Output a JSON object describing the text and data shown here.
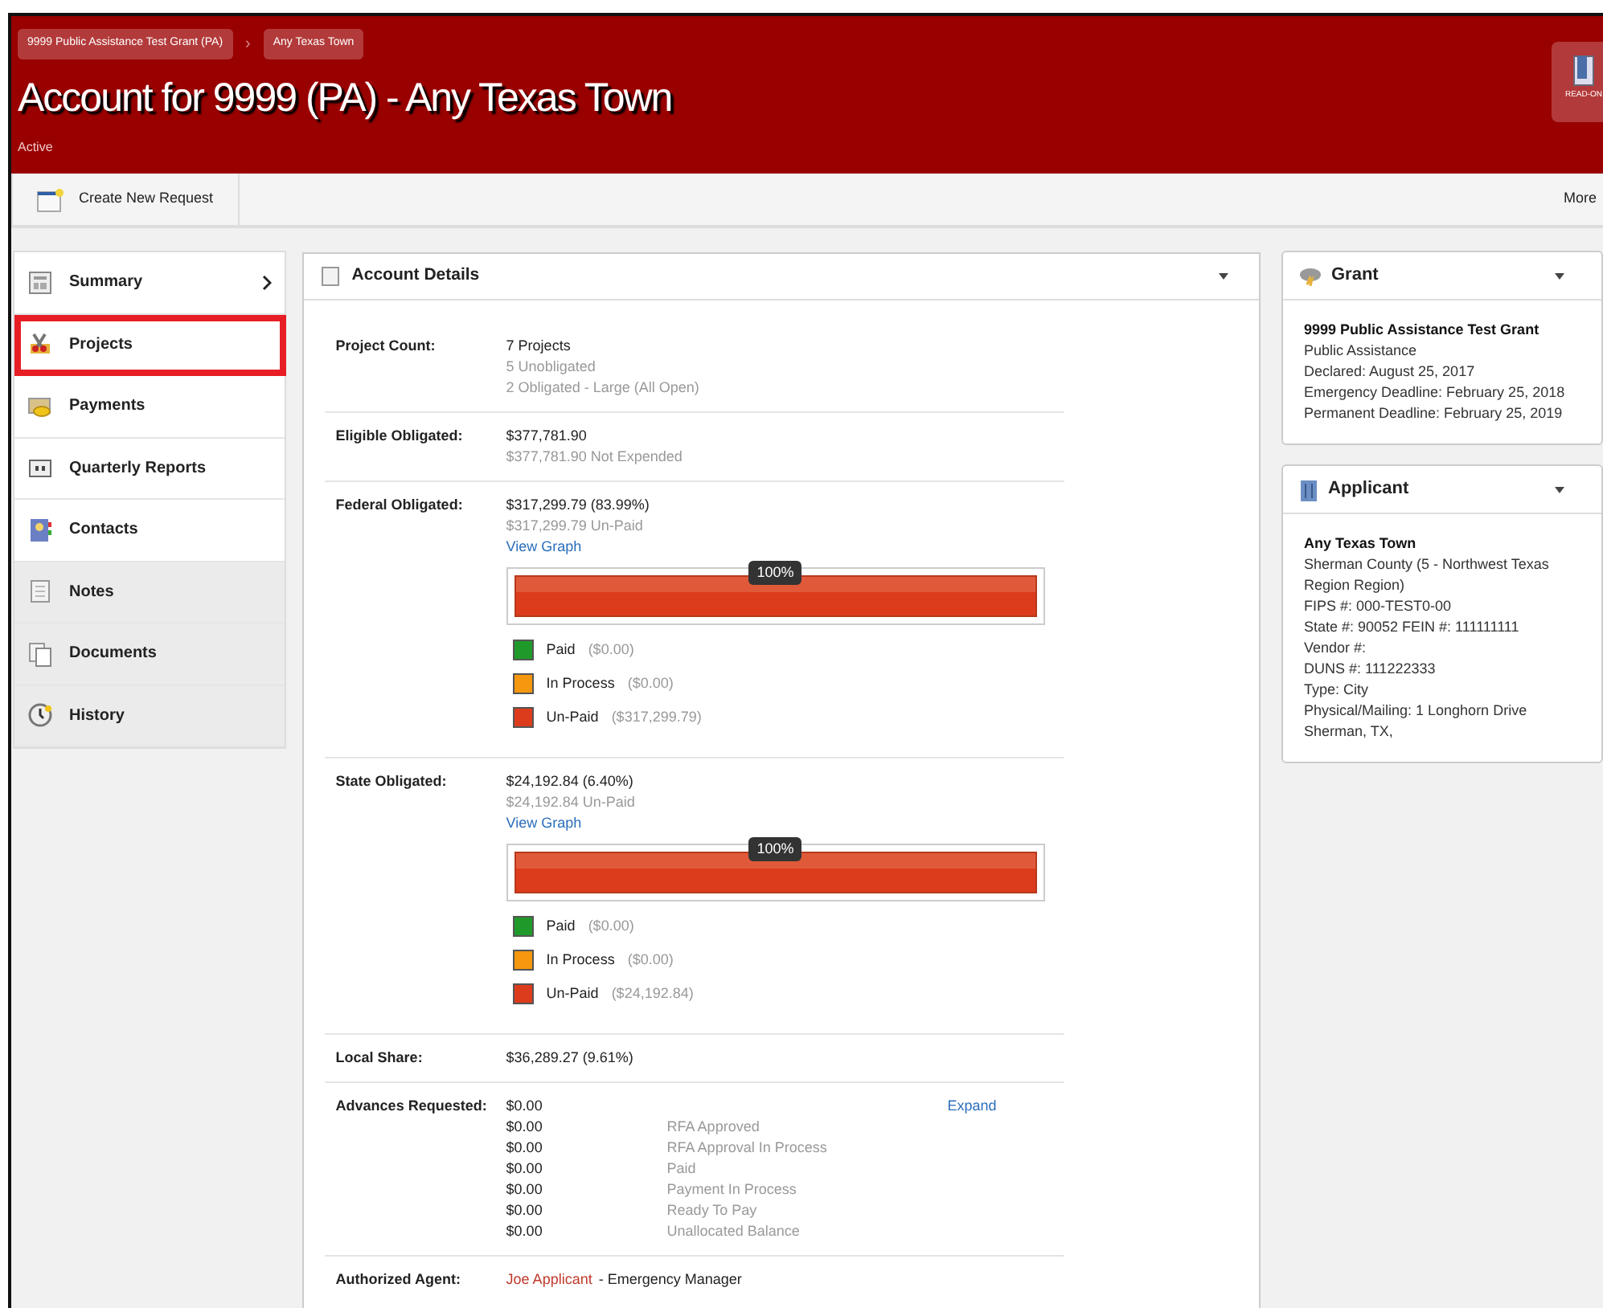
{
  "breadcrumbs": [
    {
      "label": "9999 Public Assistance Test Grant (PA)"
    },
    {
      "label": "Any Texas Town"
    }
  ],
  "breadcrumb_separator": "›",
  "title": "Account for 9999 (PA) - Any Texas Town",
  "status": "Active",
  "read_only_label": "READ-ON",
  "toolbar": {
    "create_button": "Create New Request",
    "more": "More"
  },
  "sidebar": {
    "items": [
      {
        "label": "Summary",
        "arrow": true,
        "highlighted": false,
        "shaded": false
      },
      {
        "label": "Projects",
        "arrow": false,
        "highlighted": true,
        "shaded": false
      },
      {
        "label": "Payments",
        "arrow": false,
        "highlighted": false,
        "shaded": false
      },
      {
        "label": "Quarterly Reports",
        "arrow": false,
        "highlighted": false,
        "shaded": false
      },
      {
        "label": "Contacts",
        "arrow": false,
        "highlighted": false,
        "shaded": false
      },
      {
        "label": "Notes",
        "arrow": false,
        "highlighted": false,
        "shaded": true
      },
      {
        "label": "Documents",
        "arrow": false,
        "highlighted": false,
        "shaded": true
      },
      {
        "label": "History",
        "arrow": false,
        "highlighted": false,
        "shaded": true
      }
    ]
  },
  "account_details": {
    "title": "Account Details",
    "rows": [
      {
        "kind": "lines",
        "label": "Project Count:",
        "lines": [
          {
            "text": "7 Projects",
            "muted": false
          },
          {
            "text": "5 Unobligated",
            "muted": true
          },
          {
            "text": "2 Obligated - Large (All Open)",
            "muted": true
          }
        ]
      },
      {
        "kind": "lines",
        "label": "Eligible Obligated:",
        "lines": [
          {
            "text": "$377,781.90",
            "muted": false
          },
          {
            "text": "$377,781.90 Not Expended",
            "muted": true
          }
        ]
      },
      {
        "kind": "graph",
        "label": "Federal Obligated:",
        "lines": [
          {
            "text": "$317,299.79 (83.99%)",
            "muted": false
          },
          {
            "text": "$317,299.79 Un-Paid",
            "muted": true
          }
        ],
        "link": "View Graph",
        "bar": {
          "level": 1,
          "label": "100%"
        },
        "legend": [
          {
            "label": "Paid",
            "amount": "($0.00)",
            "color": "#1f9a2a"
          },
          {
            "label": "In Process",
            "amount": "($0.00)",
            "color": "#f5970f"
          },
          {
            "label": "Un-Paid",
            "amount": "($317,299.79)",
            "color": "#dc3c1c"
          }
        ]
      },
      {
        "kind": "graph",
        "label": "State Obligated:",
        "lines": [
          {
            "text": "$24,192.84 (6.40%)",
            "muted": false
          },
          {
            "text": "$24,192.84 Un-Paid",
            "muted": true
          }
        ],
        "link": "View Graph",
        "bar": {
          "level": 1,
          "label": "100%"
        },
        "legend": [
          {
            "label": "Paid",
            "amount": "($0.00)",
            "color": "#1f9a2a"
          },
          {
            "label": "In Process",
            "amount": "($0.00)",
            "color": "#f5970f"
          },
          {
            "label": "Un-Paid",
            "amount": "($24,192.84)",
            "color": "#dc3c1c"
          }
        ]
      },
      {
        "kind": "lines",
        "label": "Local Share:",
        "lines": [
          {
            "text": "$36,289.27 (9.61%)",
            "muted": false
          }
        ]
      },
      {
        "kind": "advances",
        "label": "Advances Requested:",
        "expand": "Expand",
        "entries": [
          {
            "amount": "$0.00"
          },
          {
            "amount": "$0.00",
            "label": "RFA Approved"
          },
          {
            "amount": "$0.00",
            "label": "RFA Approval In Process"
          },
          {
            "amount": "$0.00",
            "label": "Paid"
          },
          {
            "amount": "$0.00",
            "label": "Payment In Process"
          },
          {
            "amount": "$0.00",
            "label": "Ready To Pay"
          },
          {
            "amount": "$0.00",
            "label": "Unallocated Balance"
          }
        ]
      },
      {
        "kind": "agent",
        "label": "Authorized Agent:",
        "link": "Joe Applicant",
        "rest": "- Emergency Manager"
      }
    ]
  },
  "grant": {
    "title": "Grant",
    "heading": "9999 Public Assistance Test Grant",
    "lines": [
      "Public Assistance",
      "Declared: August 25, 2017",
      "Emergency Deadline: February 25, 2018",
      "Permanent Deadline: February 25, 2019"
    ]
  },
  "applicant": {
    "title": "Applicant",
    "heading": "Any Texas Town",
    "lines": [
      "Sherman County (5 - Northwest Texas Region Region)",
      "FIPS #: 000-TEST0-00",
      "State #: 90052 FEIN #: 111111111",
      "Vendor #:",
      "DUNS #: 111222333",
      "Type: City",
      "Physical/Mailing: 1 Longhorn Drive",
      "Sherman, TX,"
    ]
  }
}
